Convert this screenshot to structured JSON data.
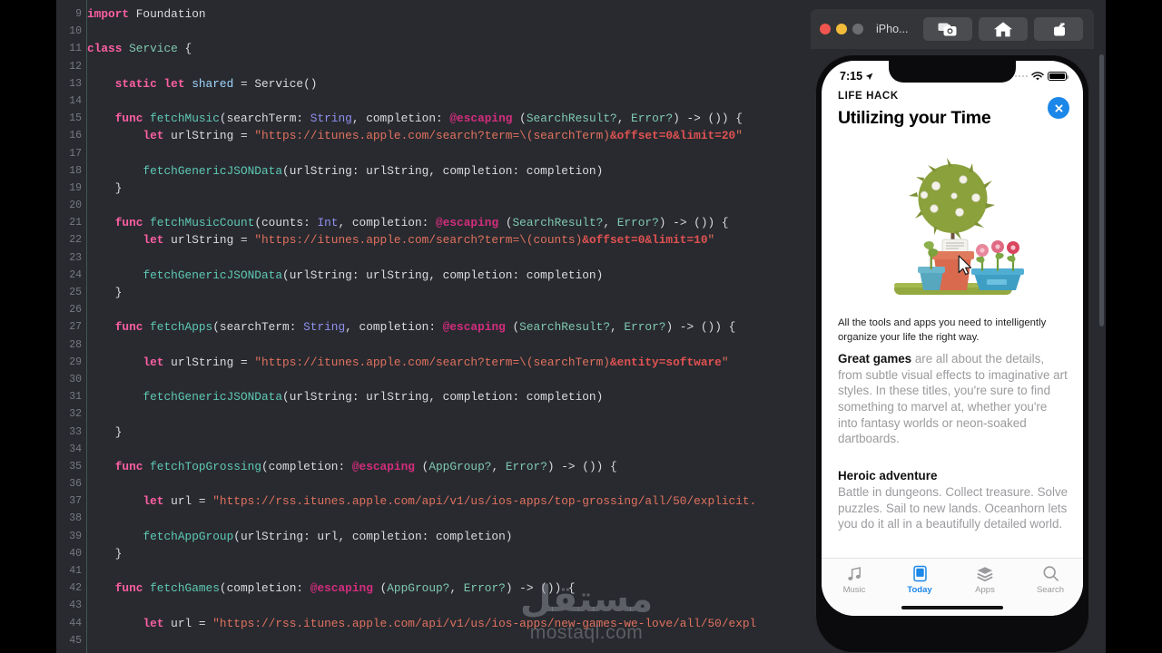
{
  "editor": {
    "language": "swift",
    "background_color": "#292a2f",
    "first_line_number": 9,
    "line_numbers": [
      9,
      10,
      11,
      12,
      13,
      14,
      15,
      16,
      17,
      18,
      19,
      20,
      21,
      22,
      23,
      24,
      25,
      26,
      27,
      28,
      29,
      30,
      31,
      32,
      33,
      34,
      35,
      36,
      37,
      38,
      39,
      40,
      41,
      42,
      43,
      44,
      45
    ],
    "lines": [
      [
        {
          "t": "import",
          "c": "k"
        },
        {
          "t": " Foundation",
          "c": "pl"
        }
      ],
      [],
      [
        {
          "t": "class",
          "c": "k"
        },
        {
          "t": " ",
          "c": "pl"
        },
        {
          "t": "Service",
          "c": "tyg"
        },
        {
          "t": " {",
          "c": "pl"
        }
      ],
      [],
      [
        {
          "t": "    ",
          "c": "pl"
        },
        {
          "t": "static let",
          "c": "k"
        },
        {
          "t": " ",
          "c": "pl"
        },
        {
          "t": "shared",
          "c": "cn"
        },
        {
          "t": " = Service()",
          "c": "pl"
        }
      ],
      [],
      [
        {
          "t": "    ",
          "c": "pl"
        },
        {
          "t": "func",
          "c": "k"
        },
        {
          "t": " ",
          "c": "pl"
        },
        {
          "t": "fetchMusic",
          "c": "fn"
        },
        {
          "t": "(searchTerm: ",
          "c": "pl"
        },
        {
          "t": "String",
          "c": "ty"
        },
        {
          "t": ", completion: ",
          "c": "pl"
        },
        {
          "t": "@escaping",
          "c": "at"
        },
        {
          "t": " (",
          "c": "pl"
        },
        {
          "t": "SearchResult?",
          "c": "tyg"
        },
        {
          "t": ", ",
          "c": "pl"
        },
        {
          "t": "Error?",
          "c": "tyg"
        },
        {
          "t": ") -> ()) {",
          "c": "pl"
        }
      ],
      [
        {
          "t": "        ",
          "c": "pl"
        },
        {
          "t": "let",
          "c": "k"
        },
        {
          "t": " urlString = ",
          "c": "pl"
        },
        {
          "t": "\"https://itunes.apple.com/search?term=\\(searchTerm)",
          "c": "st"
        },
        {
          "t": "&offset=0&limit=20",
          "c": "se"
        },
        {
          "t": "\"",
          "c": "st"
        }
      ],
      [],
      [
        {
          "t": "        ",
          "c": "pl"
        },
        {
          "t": "fetchGenericJSONData",
          "c": "fn"
        },
        {
          "t": "(urlString: urlString, completion: completion)",
          "c": "pl"
        }
      ],
      [
        {
          "t": "    }",
          "c": "pl"
        }
      ],
      [],
      [
        {
          "t": "    ",
          "c": "pl"
        },
        {
          "t": "func",
          "c": "k"
        },
        {
          "t": " ",
          "c": "pl"
        },
        {
          "t": "fetchMusicCount",
          "c": "fn"
        },
        {
          "t": "(counts: ",
          "c": "pl"
        },
        {
          "t": "Int",
          "c": "ty"
        },
        {
          "t": ", completion: ",
          "c": "pl"
        },
        {
          "t": "@escaping",
          "c": "at"
        },
        {
          "t": " (",
          "c": "pl"
        },
        {
          "t": "SearchResult?",
          "c": "tyg"
        },
        {
          "t": ", ",
          "c": "pl"
        },
        {
          "t": "Error?",
          "c": "tyg"
        },
        {
          "t": ") -> ()) {",
          "c": "pl"
        }
      ],
      [
        {
          "t": "        ",
          "c": "pl"
        },
        {
          "t": "let",
          "c": "k"
        },
        {
          "t": " urlString = ",
          "c": "pl"
        },
        {
          "t": "\"https://itunes.apple.com/search?term=\\(counts)",
          "c": "st"
        },
        {
          "t": "&offset=0&limit=10",
          "c": "se"
        },
        {
          "t": "\"",
          "c": "st"
        }
      ],
      [],
      [
        {
          "t": "        ",
          "c": "pl"
        },
        {
          "t": "fetchGenericJSONData",
          "c": "fn"
        },
        {
          "t": "(urlString: urlString, completion: completion)",
          "c": "pl"
        }
      ],
      [
        {
          "t": "    }",
          "c": "pl"
        }
      ],
      [],
      [
        {
          "t": "    ",
          "c": "pl"
        },
        {
          "t": "func",
          "c": "k"
        },
        {
          "t": " ",
          "c": "pl"
        },
        {
          "t": "fetchApps",
          "c": "fn"
        },
        {
          "t": "(searchTerm: ",
          "c": "pl"
        },
        {
          "t": "String",
          "c": "ty"
        },
        {
          "t": ", completion: ",
          "c": "pl"
        },
        {
          "t": "@escaping",
          "c": "at"
        },
        {
          "t": " (",
          "c": "pl"
        },
        {
          "t": "SearchResult?",
          "c": "tyg"
        },
        {
          "t": ", ",
          "c": "pl"
        },
        {
          "t": "Error?",
          "c": "tyg"
        },
        {
          "t": ") -> ()) {",
          "c": "pl"
        }
      ],
      [],
      [
        {
          "t": "        ",
          "c": "pl"
        },
        {
          "t": "let",
          "c": "k"
        },
        {
          "t": " urlString = ",
          "c": "pl"
        },
        {
          "t": "\"https://itunes.apple.com/search?term=\\(searchTerm)",
          "c": "st"
        },
        {
          "t": "&entity=software",
          "c": "se"
        },
        {
          "t": "\"",
          "c": "st"
        }
      ],
      [],
      [
        {
          "t": "        ",
          "c": "pl"
        },
        {
          "t": "fetchGenericJSONData",
          "c": "fn"
        },
        {
          "t": "(urlString: urlString, completion: completion)",
          "c": "pl"
        }
      ],
      [],
      [
        {
          "t": "    }",
          "c": "pl"
        }
      ],
      [],
      [
        {
          "t": "    ",
          "c": "pl"
        },
        {
          "t": "func",
          "c": "k"
        },
        {
          "t": " ",
          "c": "pl"
        },
        {
          "t": "fetchTopGrossing",
          "c": "fn"
        },
        {
          "t": "(completion: ",
          "c": "pl"
        },
        {
          "t": "@escaping",
          "c": "at"
        },
        {
          "t": " (",
          "c": "pl"
        },
        {
          "t": "AppGroup?",
          "c": "tyg"
        },
        {
          "t": ", ",
          "c": "pl"
        },
        {
          "t": "Error?",
          "c": "tyg"
        },
        {
          "t": ") -> ()) {",
          "c": "pl"
        }
      ],
      [],
      [
        {
          "t": "        ",
          "c": "pl"
        },
        {
          "t": "let",
          "c": "k"
        },
        {
          "t": " url = ",
          "c": "pl"
        },
        {
          "t": "\"https://rss.itunes.apple.com/api/v1/us/ios-apps/top-grossing/all/50/explicit.",
          "c": "st"
        }
      ],
      [],
      [
        {
          "t": "        ",
          "c": "pl"
        },
        {
          "t": "fetchAppGroup",
          "c": "fn"
        },
        {
          "t": "(urlString: url, completion: completion)",
          "c": "pl"
        }
      ],
      [
        {
          "t": "    }",
          "c": "pl"
        }
      ],
      [],
      [
        {
          "t": "    ",
          "c": "pl"
        },
        {
          "t": "func",
          "c": "k"
        },
        {
          "t": " ",
          "c": "pl"
        },
        {
          "t": "fetchGames",
          "c": "fn"
        },
        {
          "t": "(completion: ",
          "c": "pl"
        },
        {
          "t": "@escaping",
          "c": "at"
        },
        {
          "t": " (",
          "c": "pl"
        },
        {
          "t": "AppGroup?",
          "c": "tyg"
        },
        {
          "t": ", ",
          "c": "pl"
        },
        {
          "t": "Error?",
          "c": "tyg"
        },
        {
          "t": ") -> ()) {",
          "c": "pl"
        }
      ],
      [],
      [
        {
          "t": "        ",
          "c": "pl"
        },
        {
          "t": "let",
          "c": "k"
        },
        {
          "t": " url = ",
          "c": "pl"
        },
        {
          "t": "\"https://rss.itunes.apple.com/api/v1/us/ios-apps/new-games-we-love/all/50/expl",
          "c": "st"
        }
      ],
      []
    ]
  },
  "watermark": {
    "arabic": "مستقل",
    "latin": "mostaql.com"
  },
  "simulator": {
    "title": "iPho...",
    "traffic_lights": [
      "close",
      "minimize",
      "zoom"
    ],
    "toolbar_buttons": [
      {
        "name": "screenshot-button",
        "icon": "camera-icon"
      },
      {
        "name": "home-button",
        "icon": "home-icon"
      },
      {
        "name": "share-button",
        "icon": "share-icon"
      }
    ]
  },
  "phone": {
    "status_bar": {
      "time": "7:15",
      "location_icon": "location-arrow-icon",
      "wifi_icon": "wifi-icon",
      "battery_icon": "battery-icon"
    },
    "card": {
      "kicker": "LIFE HACK",
      "headline": "Utilizing your Time",
      "close_label": "✕",
      "illustration": "potted-plants-illustration",
      "blurb": "All the tools and apps you need to intelligently organize your life the right way.",
      "body_lead": "Great games",
      "body_rest": " are all about the details, from subtle visual effects to imaginative art styles. In these titles, you're sure to find something to marvel at, whether you're into fantasy worlds or neon-soaked dartboards.",
      "section_title": "Heroic adventure",
      "section_body": "Battle in dungeons. Collect treasure. Solve puzzles. Sail to new lands. Oceanhorn lets you do it all in a beautifully detailed world."
    },
    "tabs": [
      {
        "label": "Music",
        "icon": "music-note-icon",
        "active": false
      },
      {
        "label": "Today",
        "icon": "today-card-icon",
        "active": true
      },
      {
        "label": "Apps",
        "icon": "apps-stack-icon",
        "active": false
      },
      {
        "label": "Search",
        "icon": "search-icon",
        "active": false
      }
    ]
  },
  "colors": {
    "editor_bg": "#292a2f",
    "accent_blue": "#1b87e8",
    "keyword_pink": "#fc5fa3",
    "string_red": "#e0715f",
    "function_teal": "#5dc9b6",
    "type_purple": "#8f8ff0"
  }
}
